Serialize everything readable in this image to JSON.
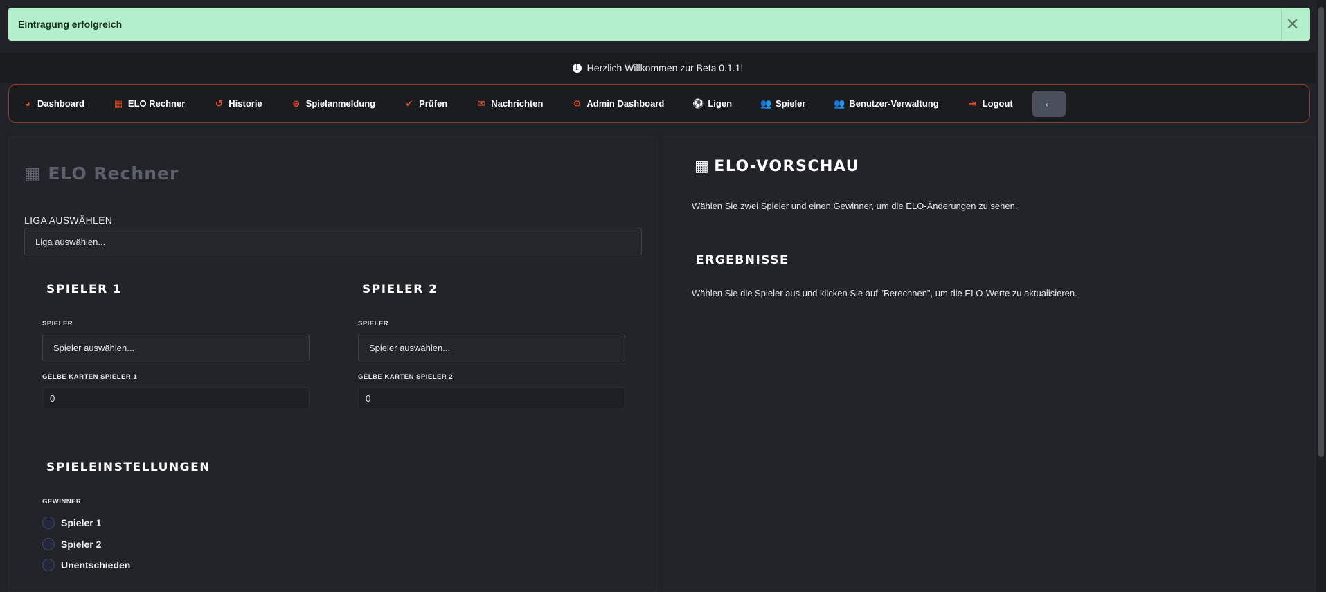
{
  "toast": {
    "message": "Eintragung erfolgreich",
    "close_symbol": "✕"
  },
  "banner": {
    "text": "Herzlich Willkommen zur Beta 0.1.1!"
  },
  "nav": {
    "items": [
      {
        "label": "Dashboard",
        "icon": "◕"
      },
      {
        "label": "ELO Rechner",
        "icon": "▦"
      },
      {
        "label": "Historie",
        "icon": "↺"
      },
      {
        "label": "Spielanmeldung",
        "icon": "⊕"
      },
      {
        "label": "Prüfen",
        "icon": "✔"
      },
      {
        "label": "Nachrichten",
        "icon": "✉"
      },
      {
        "label": "Admin Dashboard",
        "icon": "⚙"
      },
      {
        "label": "Ligen",
        "icon": "⚽"
      },
      {
        "label": "Spieler",
        "icon": "👥"
      },
      {
        "label": "Benutzer-Verwaltung",
        "icon": "👥"
      },
      {
        "label": "Logout",
        "icon": "⇥"
      }
    ],
    "back_symbol": "←"
  },
  "calculator": {
    "title": "ELO Rechner",
    "liga_label": "LIGA AUSWÄHLEN",
    "liga_placeholder": "Liga auswählen...",
    "player1": {
      "heading": "SPIELER 1",
      "player_label": "SPIELER",
      "player_placeholder": "Spieler auswählen...",
      "yellow_label": "GELBE KARTEN SPIELER 1",
      "yellow_value": "0"
    },
    "player2": {
      "heading": "SPIELER 2",
      "player_label": "SPIELER",
      "player_placeholder": "Spieler auswählen...",
      "yellow_label": "GELBE KARTEN SPIELER 2",
      "yellow_value": "0"
    },
    "settings": {
      "heading": "SPIELEINSTELLUNGEN",
      "winner_label": "GEWINNER",
      "options": [
        "Spieler 1",
        "Spieler 2",
        "Unentschieden"
      ]
    }
  },
  "preview": {
    "title": "ELO-VORSCHAU",
    "description": "Wählen Sie zwei Spieler und einen Gewinner, um die ELO-Änderungen zu sehen.",
    "results_heading": "ERGEBNISSE",
    "results_text": "Wählen Sie die Spieler aus und klicken Sie auf \"Berechnen\", um die ELO-Werte zu aktualisieren."
  },
  "colors": {
    "accent": "#ee4a24",
    "toast_bg": "#b3efcb",
    "background": "#202227"
  }
}
